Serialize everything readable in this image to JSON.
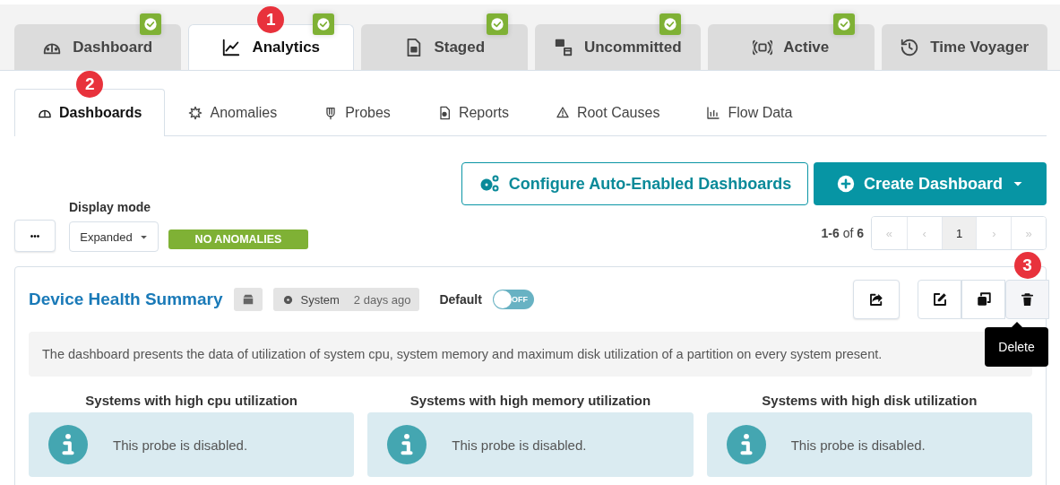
{
  "top_tabs": [
    {
      "label": "Dashboard",
      "selected": false,
      "checked": true
    },
    {
      "label": "Analytics",
      "selected": true,
      "checked": true,
      "callout": "1"
    },
    {
      "label": "Staged",
      "selected": false,
      "checked": true
    },
    {
      "label": "Uncommitted",
      "selected": false,
      "checked": true
    },
    {
      "label": "Active",
      "selected": false,
      "checked": true
    },
    {
      "label": "Time Voyager",
      "selected": false,
      "checked": false
    }
  ],
  "sub_tabs": [
    {
      "label": "Dashboards",
      "selected": true,
      "callout": "2"
    },
    {
      "label": "Anomalies",
      "selected": false
    },
    {
      "label": "Probes",
      "selected": false
    },
    {
      "label": "Reports",
      "selected": false
    },
    {
      "label": "Root Causes",
      "selected": false
    },
    {
      "label": "Flow Data",
      "selected": false
    }
  ],
  "actions": {
    "configure": "Configure Auto-Enabled Dashboards",
    "create": "Create Dashboard"
  },
  "toolbar": {
    "more": "•••",
    "display_mode_label": "Display mode",
    "display_mode": "Expanded",
    "status": "NO ANOMALIES"
  },
  "pagination": {
    "range": "1-6",
    "of": "of",
    "total": "6",
    "buttons": [
      {
        "label": "«",
        "disabled": true,
        "selected": false
      },
      {
        "label": "‹",
        "disabled": true,
        "selected": false
      },
      {
        "label": "1",
        "disabled": false,
        "selected": true
      },
      {
        "label": "›",
        "disabled": true,
        "selected": false
      },
      {
        "label": "»",
        "disabled": true,
        "selected": false
      }
    ]
  },
  "dashboard": {
    "title": "Device Health Summary",
    "source": "System",
    "age": "2 days ago",
    "default_label": "Default",
    "default_on": false,
    "toggle_text": "OFF",
    "tooltip": "Delete",
    "delete_callout": "3",
    "description": "The dashboard presents the data of utilization of system cpu, system memory and maximum disk utilization of a partition on every system present.",
    "widgets": [
      {
        "title": "Systems with high cpu utilization",
        "message": "This probe is disabled."
      },
      {
        "title": "Systems with high memory utilization",
        "message": "This probe is disabled."
      },
      {
        "title": "Systems with high disk utilization",
        "message": "This probe is disabled."
      }
    ]
  }
}
